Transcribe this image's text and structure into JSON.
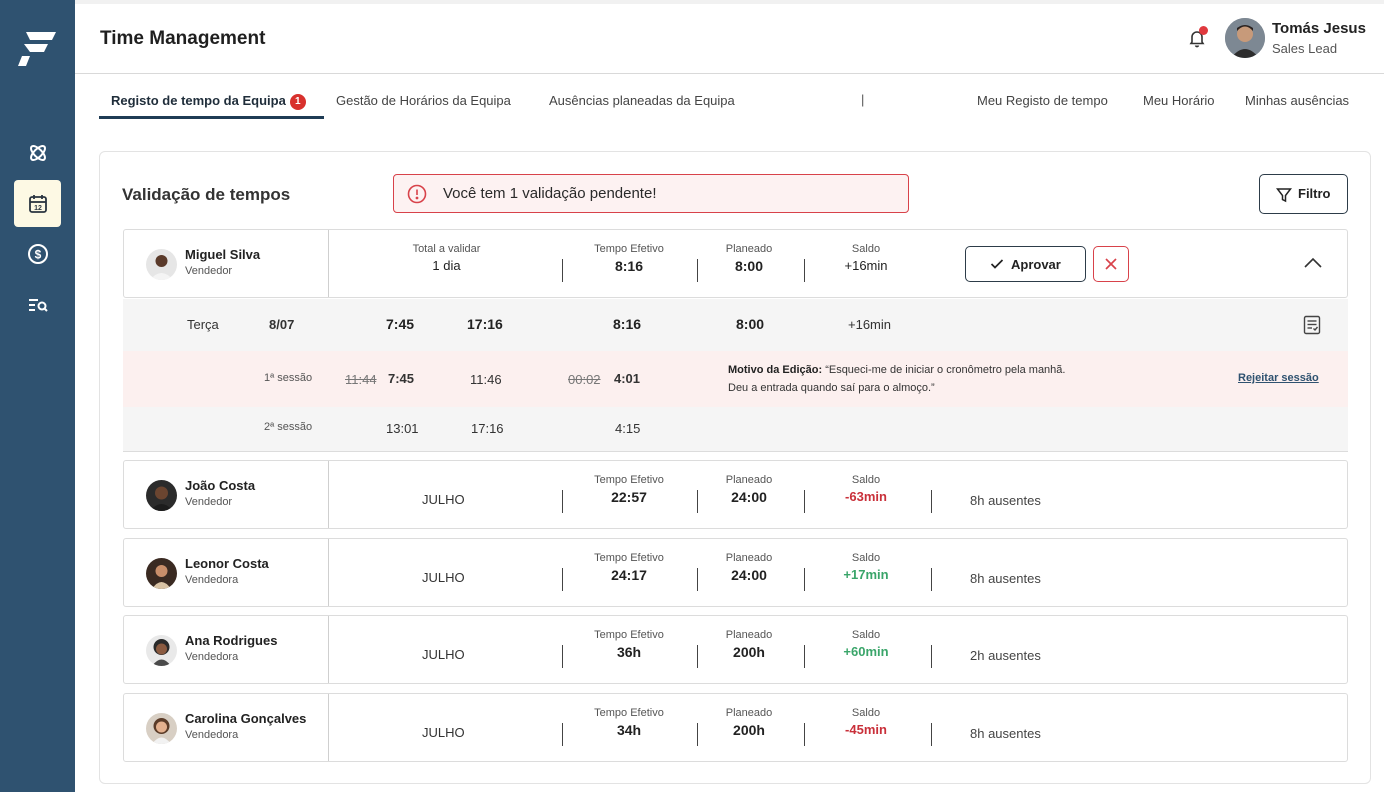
{
  "app": {
    "title": "Time Management"
  },
  "user": {
    "name": "Tomás Jesus",
    "role": "Sales Lead"
  },
  "tabs": {
    "left": [
      {
        "label": "Registo de tempo da Equipa",
        "badge": "1"
      },
      {
        "label": "Gestão de Horários da Equipa"
      },
      {
        "label": "Ausências planeadas da Equipa"
      }
    ],
    "separator": "|",
    "right": [
      {
        "label": "Meu Registo de tempo"
      },
      {
        "label": "Meu Horário"
      },
      {
        "label": "Minhas ausências"
      }
    ]
  },
  "card": {
    "title": "Validação de tempos",
    "alert": "Você tem 1 validação pendente!",
    "filter_label": "Filtro"
  },
  "expanded": {
    "name": "Miguel Silva",
    "role": "Vendedor",
    "total_label": "Total a validar",
    "total_value": "1 dia",
    "effective_label": "Tempo Efetivo",
    "effective_value": "8:16",
    "planned_label": "Planeado",
    "planned_value": "8:00",
    "balance_label": "Saldo",
    "balance_value": "+16min",
    "approve_label": "Aprovar",
    "day": {
      "weekday": "Terça",
      "date": "8/07",
      "start": "7:45",
      "end": "17:16",
      "effective": "8:16",
      "planned": "8:00",
      "balance": "+16min"
    },
    "sessions": [
      {
        "label": "1ª sessão",
        "old_start": "11:44",
        "start": "7:45",
        "end": "11:46",
        "old_duration": "00:02",
        "duration": "4:01",
        "reason_title": "Motivo da Edição:",
        "reason_line1": "“Esqueci-me de iniciar o cronômetro pela manhã.",
        "reason_line2": "Deu a entrada quando saí para o almoço.”",
        "reject_label": "Rejeitar sessão"
      },
      {
        "label": "2ª sessão",
        "start": "13:01",
        "end": "17:16",
        "duration": "4:15"
      }
    ]
  },
  "rows": [
    {
      "name": "João Costa",
      "role": "Vendedor",
      "month": "JULHO",
      "effective": "22:57",
      "planned": "24:00",
      "balance": "-63min",
      "balance_sign": "neg",
      "absent": "8h ausentes"
    },
    {
      "name": "Leonor Costa",
      "role": "Vendedora",
      "month": "JULHO",
      "effective": "24:17",
      "planned": "24:00",
      "balance": "+17min",
      "balance_sign": "pos",
      "absent": "8h ausentes"
    },
    {
      "name": "Ana Rodrigues",
      "role": "Vendedora",
      "month": "JULHO",
      "effective": "36h",
      "planned": "200h",
      "balance": "+60min",
      "balance_sign": "pos",
      "absent": "2h ausentes"
    },
    {
      "name": "Carolina Gonçalves",
      "role": "Vendedora",
      "month": "JULHO",
      "effective": "34h",
      "planned": "200h",
      "balance": "-45min",
      "balance_sign": "neg",
      "absent": "8h ausentes"
    }
  ],
  "labels": {
    "effective": "Tempo Efetivo",
    "planned": "Planeado",
    "balance": "Saldo"
  },
  "colors": {
    "sidebar": "#2f5270",
    "danger": "#d8424a",
    "positive": "#3aa56a",
    "negative": "#c9303a"
  }
}
